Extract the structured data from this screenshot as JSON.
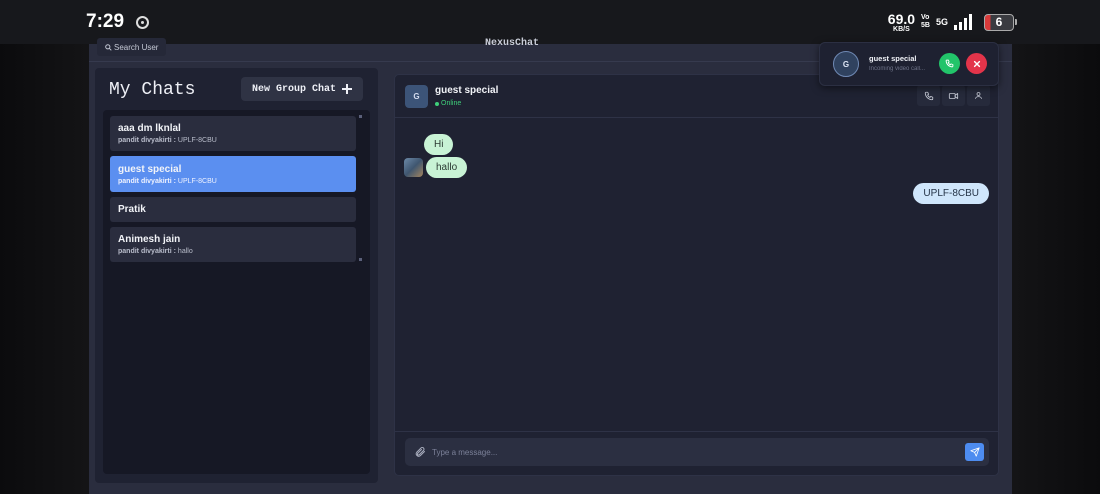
{
  "status_bar": {
    "time": "7:29",
    "speed_value": "69.0",
    "speed_unit": "KB/S",
    "volte_top": "Vo",
    "volte_bottom": "5B",
    "network": "5G",
    "battery": "6"
  },
  "app": {
    "brand": "NexusChat",
    "search_label": "Search User"
  },
  "sidebar": {
    "title": "My Chats",
    "new_group_label": "New Group Chat",
    "chats": [
      {
        "name": "aaa dm lknlal",
        "sender": "pandit divyakirti :",
        "message": "UPLF-8CBU",
        "active": false
      },
      {
        "name": "guest special",
        "sender": "pandit divyakirti :",
        "message": "UPLF-8CBU",
        "active": true
      },
      {
        "name": "Pratik",
        "sender": "",
        "message": "",
        "active": false
      },
      {
        "name": "Animesh jain",
        "sender": "pandit divyakirti :",
        "message": "hallo",
        "active": false
      }
    ]
  },
  "chat": {
    "avatar_letter": "G",
    "name": "guest special",
    "status": "Online",
    "messages": [
      {
        "text": "Hi",
        "direction": "in"
      },
      {
        "text": "hallo",
        "direction": "in"
      },
      {
        "text": "UPLF-8CBU",
        "direction": "out"
      }
    ],
    "input_placeholder": "Type a message..."
  },
  "call_popup": {
    "avatar_letter": "G",
    "name": "guest special",
    "subtitle": "Incoming video call..."
  },
  "colors": {
    "accent": "#5b8ff0",
    "online": "#3fcf7a",
    "accept": "#22c46a",
    "decline": "#e3344a"
  }
}
